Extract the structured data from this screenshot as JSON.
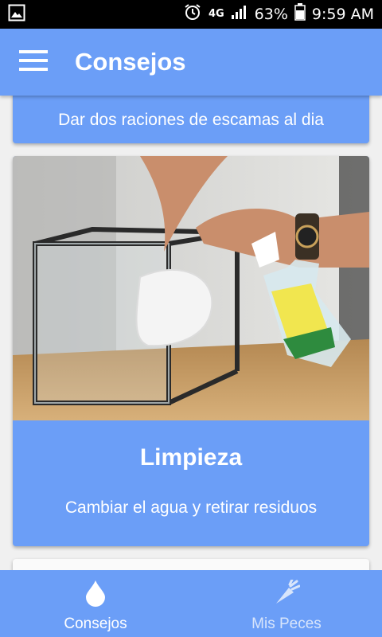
{
  "status_bar": {
    "network": "4G",
    "battery": "63%",
    "time": "9:59 AM",
    "icons": [
      "gallery-icon",
      "alarm-icon",
      "signal-icon",
      "battery-icon"
    ]
  },
  "app_bar": {
    "title": "Consejos",
    "menu_icon": "menu-icon"
  },
  "cards": [
    {
      "description": "Dar dos raciones de escamas al dia"
    },
    {
      "image": "aquarium-cleaning-photo",
      "title": "Limpieza",
      "description": "Cambiar el agua y retirar residuos"
    }
  ],
  "bottom_nav": {
    "items": [
      {
        "label": "Consejos",
        "icon": "water-drop-icon",
        "active": true
      },
      {
        "label": "Mis Peces",
        "icon": "carrot-icon",
        "active": false
      }
    ]
  },
  "colors": {
    "primary": "#6b9ef7",
    "status_bar": "#000000",
    "background": "#f0f0f0"
  }
}
